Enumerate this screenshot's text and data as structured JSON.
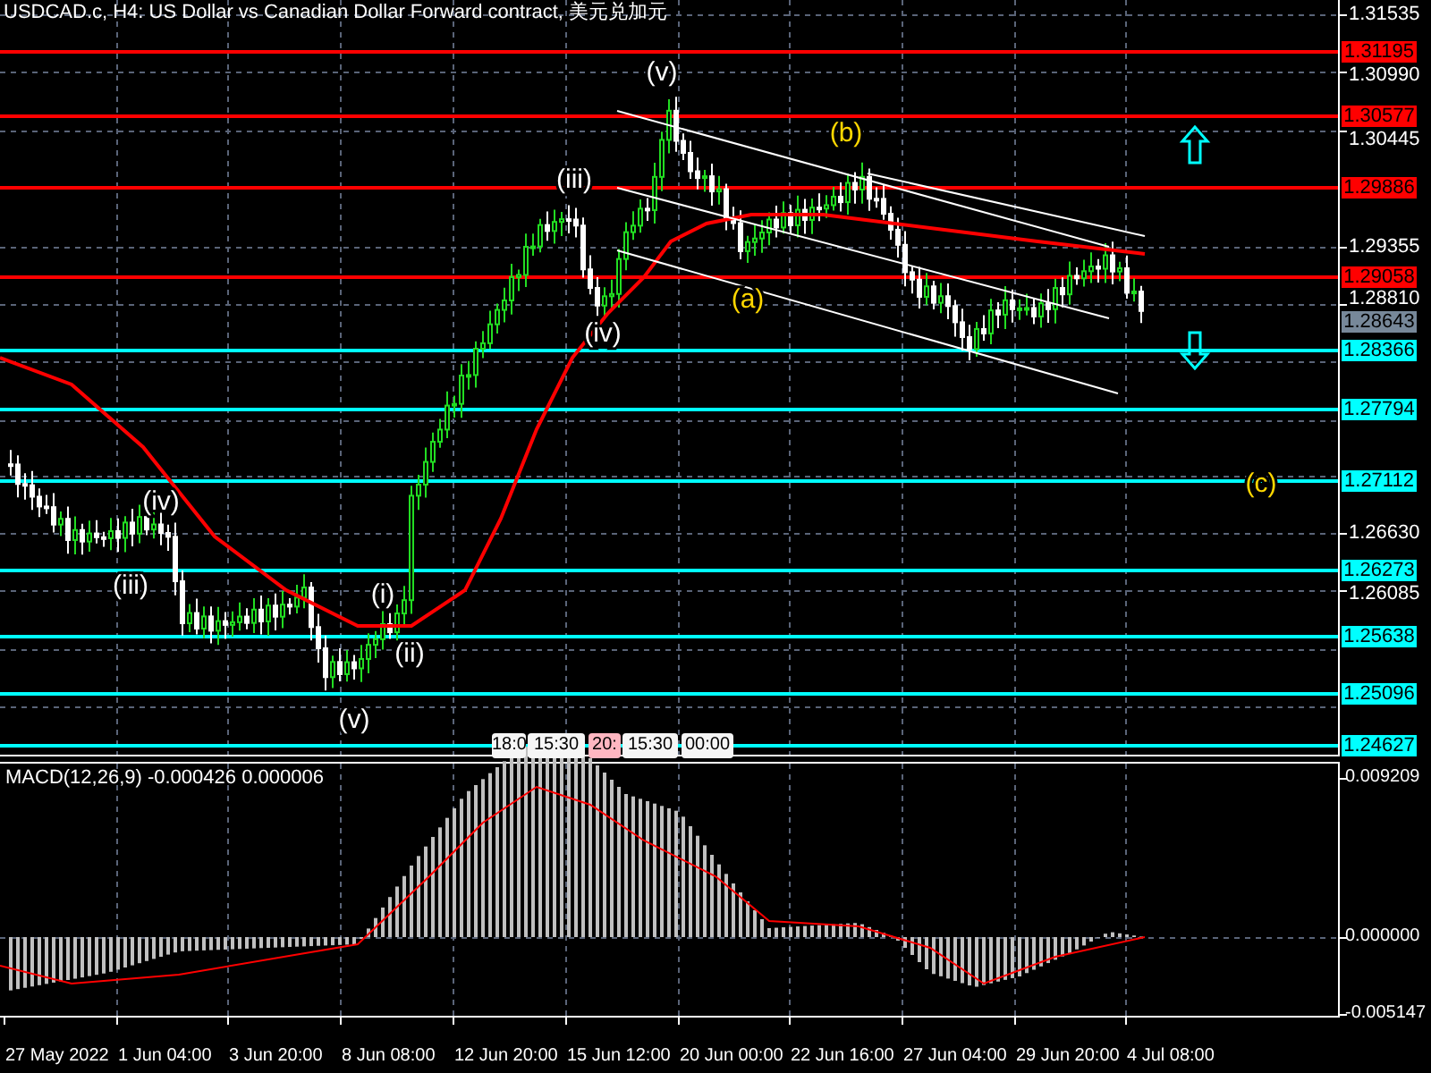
{
  "title": "USDCAD.c, H4:  US Dollar vs Canadian Dollar Forward contract, 美元兑加元",
  "price_ticks": [
    "1.31535",
    "1.30990",
    "1.30445",
    "1.29355",
    "1.28810",
    "1.26630",
    "1.26085"
  ],
  "levels": [
    {
      "label": "1.31195",
      "kind": "level",
      "color": "#ff0000"
    },
    {
      "label": "1.30577",
      "kind": "level",
      "color": "#ff0000"
    },
    {
      "label": "1.29886",
      "kind": "level",
      "color": "#ff0000"
    },
    {
      "label": "1.29058",
      "kind": "level",
      "color": "#ff0000"
    },
    {
      "label": "1.28643",
      "kind": "current",
      "color": "#778899"
    },
    {
      "label": "1.28366",
      "kind": "level",
      "color": "#00ffff"
    },
    {
      "label": "1.27794",
      "kind": "level",
      "color": "#00ffff"
    },
    {
      "label": "1.27112",
      "kind": "level",
      "color": "#00ffff"
    },
    {
      "label": "1.26273",
      "kind": "level",
      "color": "#00ffff"
    },
    {
      "label": "1.25638",
      "kind": "level",
      "color": "#00ffff"
    },
    {
      "label": "1.25096",
      "kind": "level",
      "color": "#00ffff"
    },
    {
      "label": "1.24627",
      "kind": "level",
      "color": "#00ffff"
    }
  ],
  "wave_labels": [
    {
      "text": "(v)",
      "color": "#ffffff"
    },
    {
      "text": "(iii)",
      "color": "#ffffff"
    },
    {
      "text": "(iv)",
      "color": "#ffffff"
    },
    {
      "text": "(b)",
      "color": "#ffd700"
    },
    {
      "text": "(a)",
      "color": "#ffd700"
    },
    {
      "text": "(c)",
      "color": "#ffd700"
    },
    {
      "text": "(iv)",
      "color": "#ffffff"
    },
    {
      "text": "(iii)",
      "color": "#ffffff"
    },
    {
      "text": "(i)",
      "color": "#ffffff"
    },
    {
      "text": "(ii)",
      "color": "#ffffff"
    },
    {
      "text": "(v)",
      "color": "#ffffff"
    }
  ],
  "time_scroll": [
    {
      "text": "18:0",
      "selected": false
    },
    {
      "text": "15:30",
      "selected": false
    },
    {
      "text": "20:",
      "selected": true
    },
    {
      "text": "15:30",
      "selected": false
    },
    {
      "text": "00:00",
      "selected": false
    }
  ],
  "macd": {
    "title": "MACD(12,26,9) -0.000426 0.000006",
    "ticks": [
      "0.009209",
      "0.000000",
      "-0.005147"
    ]
  },
  "time_axis": [
    "27 May 2022",
    "1 Jun 04:00",
    "3 Jun 20:00",
    "8 Jun 08:00",
    "12 Jun 20:00",
    "15 Jun 12:00",
    "20 Jun 00:00",
    "22 Jun 16:00",
    "27 Jun 04:00",
    "29 Jun 20:00",
    "4 Jul 08:00"
  ]
}
